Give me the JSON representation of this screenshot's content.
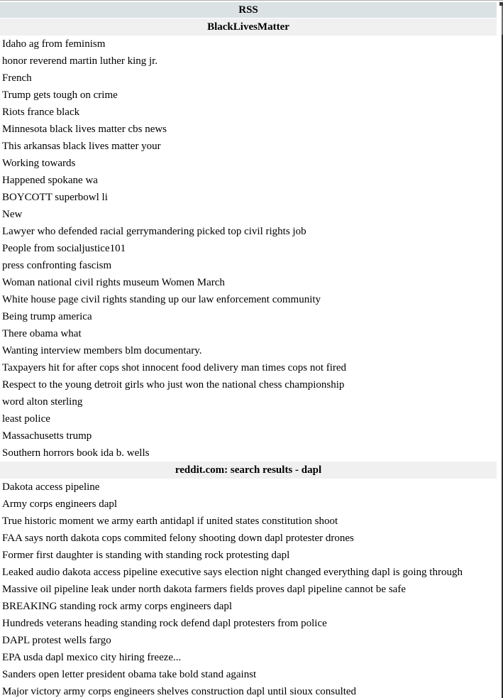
{
  "window": {
    "title": "RSS"
  },
  "scrollbar": {
    "orientation": "vertical"
  },
  "sections": [
    {
      "header": "BlackLivesMatter",
      "items": [
        "Idaho ag from feminism",
        "honor reverend martin luther king jr.",
        "French",
        "Trump gets tough on crime",
        "Riots france black",
        "Minnesota black lives matter cbs news",
        "This arkansas black lives matter your",
        "Working towards",
        "Happened spokane wa",
        "BOYCOTT superbowl li",
        "New",
        "Lawyer who defended racial gerrymandering picked top civil rights job",
        "People from socialjustice101",
        "press confronting fascism",
        "Woman national civil rights museum Women March",
        "White house page civil rights standing up our law enforcement community",
        "Being trump america",
        "There obama what",
        "Wanting interview members blm documentary.",
        "Taxpayers hit for after cops shot innocent food delivery man times cops not fired",
        "Respect to the young detroit girls who just won the national chess championship",
        "word alton sterling",
        "least police",
        "Massachusetts trump",
        "Southern horrors book ida b. wells"
      ]
    },
    {
      "header": "reddit.com: search results - dapl",
      "items": [
        "Dakota access pipeline",
        "Army corps engineers dapl",
        "True historic moment we army earth antidapl if united states constitution shoot",
        "FAA says north dakota cops commited felony shooting down dapl protester drones",
        "Former first daughter is standing with standing rock protesting dapl",
        "Leaked audio dakota access pipeline executive says election night changed everything dapl is going through",
        "Massive oil pipeline leak under north dakota farmers fields proves dapl pipeline cannot be safe",
        "BREAKING standing rock army corps engineers dapl",
        "Hundreds veterans heading standing rock defend dapl protesters from police",
        "DAPL protest wells fargo",
        "EPA usda dapl mexico city hiring freeze...",
        "Sanders open letter president obama take bold stand against",
        "Major victory army corps engineers shelves construction dapl until sioux consulted"
      ]
    }
  ],
  "colors": {
    "title_bar_bg": "#dbe2e4",
    "section_header_bg": "#f0f0f0",
    "text": "#000000",
    "page_bg": "#ffffff"
  }
}
